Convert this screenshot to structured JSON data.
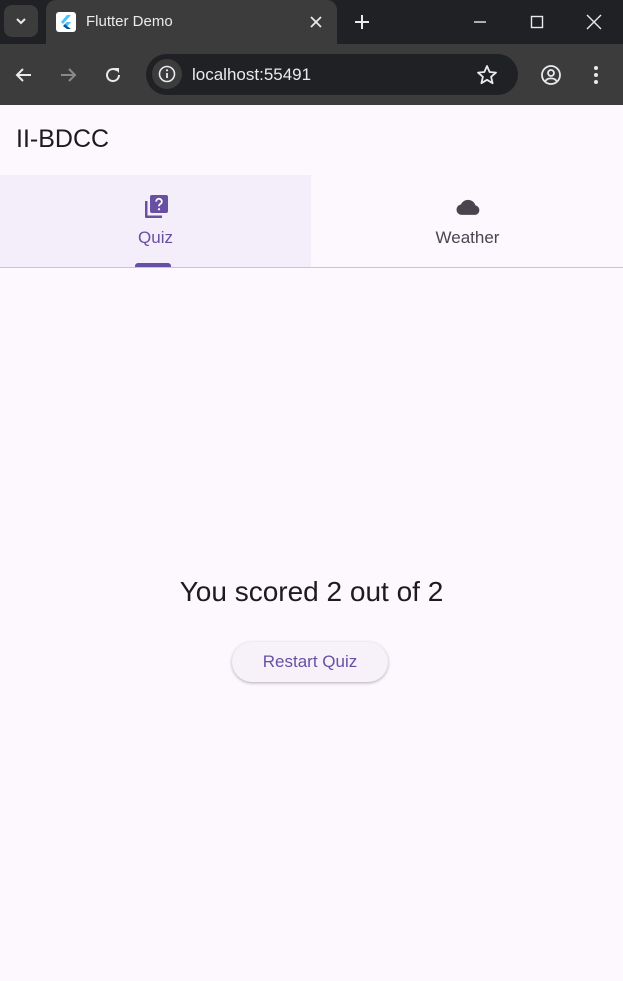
{
  "browser": {
    "tab_title": "Flutter Demo",
    "url": "localhost:55491",
    "icons": {
      "tab_search": "chevron-down-icon",
      "favicon": "flutter-logo-icon",
      "tab_close": "close-icon",
      "new_tab": "plus-icon",
      "minimize": "minimize-icon",
      "maximize": "maximize-icon",
      "close_window": "close-icon",
      "back": "arrow-left-icon",
      "forward": "arrow-right-icon",
      "reload": "reload-icon",
      "site_info": "info-icon",
      "bookmark": "star-icon",
      "profile": "profile-icon",
      "menu": "kebab-menu-icon"
    }
  },
  "app": {
    "title": "II-BDCC",
    "tabs": [
      {
        "label": "Quiz",
        "icon": "quiz-icon",
        "selected": true
      },
      {
        "label": "Weather",
        "icon": "cloud-icon",
        "selected": false
      }
    ],
    "result_text": "You scored 2 out of 2",
    "restart_label": "Restart Quiz"
  },
  "colors": {
    "primary": "#6750a4",
    "background": "#fdf7fe",
    "browser_frame": "#202124",
    "browser_toolbar": "#3c3c3c"
  }
}
